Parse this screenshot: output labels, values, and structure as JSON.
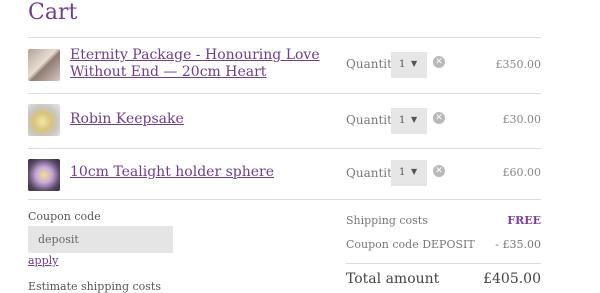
{
  "title": "Cart",
  "items": [
    {
      "name": "Eternity Package - Honouring Love Without End — 20cm Heart",
      "quantity_label": "Quantity",
      "quantity": "1",
      "price": "£350.00"
    },
    {
      "name": "Robin Keepsake",
      "quantity_label": "Quantity",
      "quantity": "1",
      "price": "£30.00"
    },
    {
      "name": "10cm Tealight holder sphere",
      "quantity_label": "Quantity",
      "quantity": "1",
      "price": "£60.00"
    }
  ],
  "coupon": {
    "label": "Coupon code",
    "value": "deposit",
    "apply_label": "apply"
  },
  "estimate_label": "Estimate shipping costs",
  "summary": {
    "shipping_label": "Shipping costs",
    "shipping_value": "FREE",
    "coupon_label": "Coupon code DEPOSIT",
    "coupon_value": "- £35.00",
    "total_label": "Total amount",
    "total_value": "£405.00"
  },
  "colors": {
    "accent": "#6e3d8c",
    "divider": "#dcdcdc",
    "field_bg": "#e5e5e5"
  },
  "icons": {
    "remove": "remove-circle-x-icon",
    "dropdown": "caret-down-icon"
  }
}
